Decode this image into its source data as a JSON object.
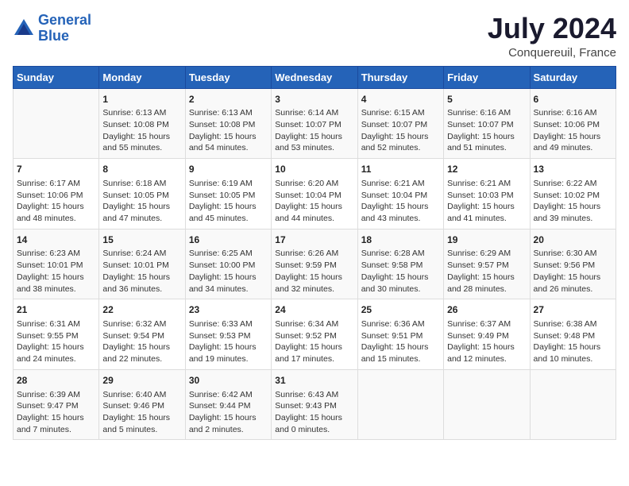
{
  "header": {
    "logo_line1": "General",
    "logo_line2": "Blue",
    "month": "July 2024",
    "location": "Conquereuil, France"
  },
  "days_of_week": [
    "Sunday",
    "Monday",
    "Tuesday",
    "Wednesday",
    "Thursday",
    "Friday",
    "Saturday"
  ],
  "weeks": [
    [
      {
        "day": "",
        "info": ""
      },
      {
        "day": "1",
        "info": "Sunrise: 6:13 AM\nSunset: 10:08 PM\nDaylight: 15 hours\nand 55 minutes."
      },
      {
        "day": "2",
        "info": "Sunrise: 6:13 AM\nSunset: 10:08 PM\nDaylight: 15 hours\nand 54 minutes."
      },
      {
        "day": "3",
        "info": "Sunrise: 6:14 AM\nSunset: 10:07 PM\nDaylight: 15 hours\nand 53 minutes."
      },
      {
        "day": "4",
        "info": "Sunrise: 6:15 AM\nSunset: 10:07 PM\nDaylight: 15 hours\nand 52 minutes."
      },
      {
        "day": "5",
        "info": "Sunrise: 6:16 AM\nSunset: 10:07 PM\nDaylight: 15 hours\nand 51 minutes."
      },
      {
        "day": "6",
        "info": "Sunrise: 6:16 AM\nSunset: 10:06 PM\nDaylight: 15 hours\nand 49 minutes."
      }
    ],
    [
      {
        "day": "7",
        "info": "Sunrise: 6:17 AM\nSunset: 10:06 PM\nDaylight: 15 hours\nand 48 minutes."
      },
      {
        "day": "8",
        "info": "Sunrise: 6:18 AM\nSunset: 10:05 PM\nDaylight: 15 hours\nand 47 minutes."
      },
      {
        "day": "9",
        "info": "Sunrise: 6:19 AM\nSunset: 10:05 PM\nDaylight: 15 hours\nand 45 minutes."
      },
      {
        "day": "10",
        "info": "Sunrise: 6:20 AM\nSunset: 10:04 PM\nDaylight: 15 hours\nand 44 minutes."
      },
      {
        "day": "11",
        "info": "Sunrise: 6:21 AM\nSunset: 10:04 PM\nDaylight: 15 hours\nand 43 minutes."
      },
      {
        "day": "12",
        "info": "Sunrise: 6:21 AM\nSunset: 10:03 PM\nDaylight: 15 hours\nand 41 minutes."
      },
      {
        "day": "13",
        "info": "Sunrise: 6:22 AM\nSunset: 10:02 PM\nDaylight: 15 hours\nand 39 minutes."
      }
    ],
    [
      {
        "day": "14",
        "info": "Sunrise: 6:23 AM\nSunset: 10:01 PM\nDaylight: 15 hours\nand 38 minutes."
      },
      {
        "day": "15",
        "info": "Sunrise: 6:24 AM\nSunset: 10:01 PM\nDaylight: 15 hours\nand 36 minutes."
      },
      {
        "day": "16",
        "info": "Sunrise: 6:25 AM\nSunset: 10:00 PM\nDaylight: 15 hours\nand 34 minutes."
      },
      {
        "day": "17",
        "info": "Sunrise: 6:26 AM\nSunset: 9:59 PM\nDaylight: 15 hours\nand 32 minutes."
      },
      {
        "day": "18",
        "info": "Sunrise: 6:28 AM\nSunset: 9:58 PM\nDaylight: 15 hours\nand 30 minutes."
      },
      {
        "day": "19",
        "info": "Sunrise: 6:29 AM\nSunset: 9:57 PM\nDaylight: 15 hours\nand 28 minutes."
      },
      {
        "day": "20",
        "info": "Sunrise: 6:30 AM\nSunset: 9:56 PM\nDaylight: 15 hours\nand 26 minutes."
      }
    ],
    [
      {
        "day": "21",
        "info": "Sunrise: 6:31 AM\nSunset: 9:55 PM\nDaylight: 15 hours\nand 24 minutes."
      },
      {
        "day": "22",
        "info": "Sunrise: 6:32 AM\nSunset: 9:54 PM\nDaylight: 15 hours\nand 22 minutes."
      },
      {
        "day": "23",
        "info": "Sunrise: 6:33 AM\nSunset: 9:53 PM\nDaylight: 15 hours\nand 19 minutes."
      },
      {
        "day": "24",
        "info": "Sunrise: 6:34 AM\nSunset: 9:52 PM\nDaylight: 15 hours\nand 17 minutes."
      },
      {
        "day": "25",
        "info": "Sunrise: 6:36 AM\nSunset: 9:51 PM\nDaylight: 15 hours\nand 15 minutes."
      },
      {
        "day": "26",
        "info": "Sunrise: 6:37 AM\nSunset: 9:49 PM\nDaylight: 15 hours\nand 12 minutes."
      },
      {
        "day": "27",
        "info": "Sunrise: 6:38 AM\nSunset: 9:48 PM\nDaylight: 15 hours\nand 10 minutes."
      }
    ],
    [
      {
        "day": "28",
        "info": "Sunrise: 6:39 AM\nSunset: 9:47 PM\nDaylight: 15 hours\nand 7 minutes."
      },
      {
        "day": "29",
        "info": "Sunrise: 6:40 AM\nSunset: 9:46 PM\nDaylight: 15 hours\nand 5 minutes."
      },
      {
        "day": "30",
        "info": "Sunrise: 6:42 AM\nSunset: 9:44 PM\nDaylight: 15 hours\nand 2 minutes."
      },
      {
        "day": "31",
        "info": "Sunrise: 6:43 AM\nSunset: 9:43 PM\nDaylight: 15 hours\nand 0 minutes."
      },
      {
        "day": "",
        "info": ""
      },
      {
        "day": "",
        "info": ""
      },
      {
        "day": "",
        "info": ""
      }
    ]
  ]
}
